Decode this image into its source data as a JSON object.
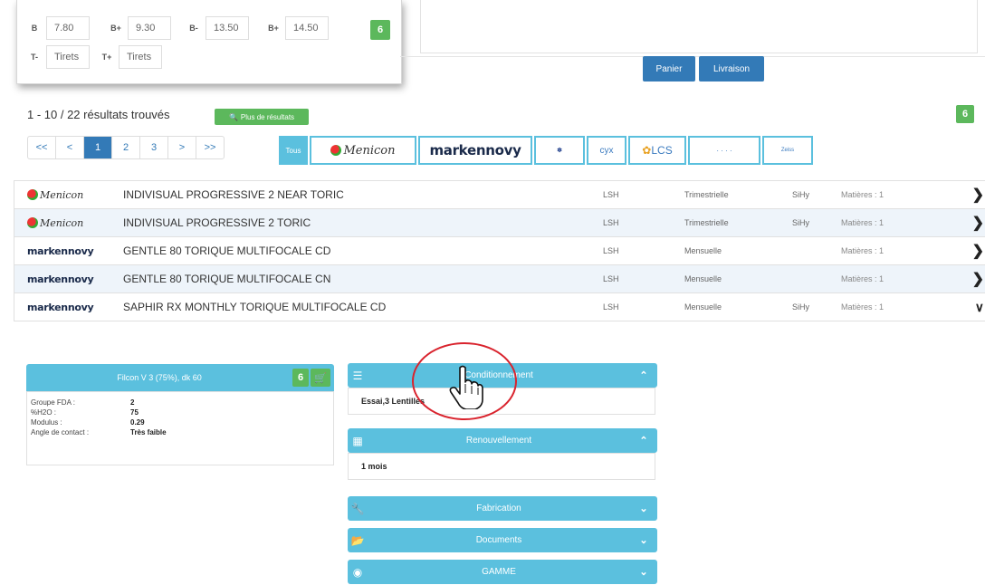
{
  "params": {
    "row1": [
      {
        "label": "B",
        "value": "7.80"
      },
      {
        "label": "B+",
        "value": "9.30"
      },
      {
        "label": "B-",
        "value": "13.50"
      },
      {
        "label": "B+",
        "value": "14.50"
      }
    ],
    "row2": [
      {
        "label": "T-",
        "value": "Tirets"
      },
      {
        "label": "T+",
        "value": "Tirets"
      }
    ],
    "action_badge": "6"
  },
  "top_buttons": {
    "panier": "Panier",
    "livraison": "Livraison"
  },
  "side_badge": "6",
  "results": {
    "summary": "1 - 10 / 22 résultats trouvés",
    "more_label": "Plus de résultats"
  },
  "pagination": [
    "<<",
    "<",
    "1",
    "2",
    "3",
    ">",
    ">>"
  ],
  "brands": {
    "tous": "Tous",
    "menicon": "Menicon",
    "markennovy": "markennovy",
    "cyx": "cyx",
    "lcs": "LCS",
    "other": "Zeiss"
  },
  "products": [
    {
      "brand": "Menicon",
      "name": "INDIVISUAL PROGRESSIVE 2 NEAR TORIC",
      "type": "LSH",
      "renewal": "Trimestrielle",
      "material": "SiHy",
      "count": "Matières : 1",
      "open": false
    },
    {
      "brand": "Menicon",
      "name": "INDIVISUAL PROGRESSIVE 2 TORIC",
      "type": "LSH",
      "renewal": "Trimestrielle",
      "material": "SiHy",
      "count": "Matières : 1",
      "open": false
    },
    {
      "brand": "markennovy",
      "name": "GENTLE 80 TORIQUE MULTIFOCALE CD",
      "type": "LSH",
      "renewal": "Mensuelle",
      "material": "",
      "count": "Matières : 1",
      "open": false
    },
    {
      "brand": "markennovy",
      "name": "GENTLE 80 TORIQUE MULTIFOCALE CN",
      "type": "LSH",
      "renewal": "Mensuelle",
      "material": "",
      "count": "Matières : 1",
      "open": false
    },
    {
      "brand": "markennovy",
      "name": "SAPHIR RX MONTHLY TORIQUE MULTIFOCALE CD",
      "type": "LSH",
      "renewal": "Mensuelle",
      "material": "SiHy",
      "count": "Matières : 1",
      "open": true
    }
  ],
  "lens": {
    "title": "Filcon V 3 (75%), dk 60",
    "badge": "6",
    "rows": [
      {
        "k": "Groupe FDA :",
        "v": "2"
      },
      {
        "k": "%H2O :",
        "v": "75"
      },
      {
        "k": "Modulus :",
        "v": "0.29"
      },
      {
        "k": "Angle de contact :",
        "v": "Très faible"
      }
    ]
  },
  "accordion": [
    {
      "label": "Conditionnement",
      "body": "Essai,3 Lentilles",
      "open": true,
      "icon": "list-icon"
    },
    {
      "label": "Renouvellement",
      "body": "1 mois",
      "open": true,
      "icon": "calendar-icon"
    },
    {
      "label": "Fabrication",
      "body": "",
      "open": false,
      "icon": "wrench-icon"
    },
    {
      "label": "Documents",
      "body": "",
      "open": false,
      "icon": "folder-icon"
    },
    {
      "label": "GAMME",
      "body": "",
      "open": false,
      "icon": "eye-icon"
    }
  ],
  "colors": {
    "accent": "#5bc0de",
    "primary": "#337ab7",
    "success": "#5cb85c",
    "highlight": "#d9232d"
  }
}
